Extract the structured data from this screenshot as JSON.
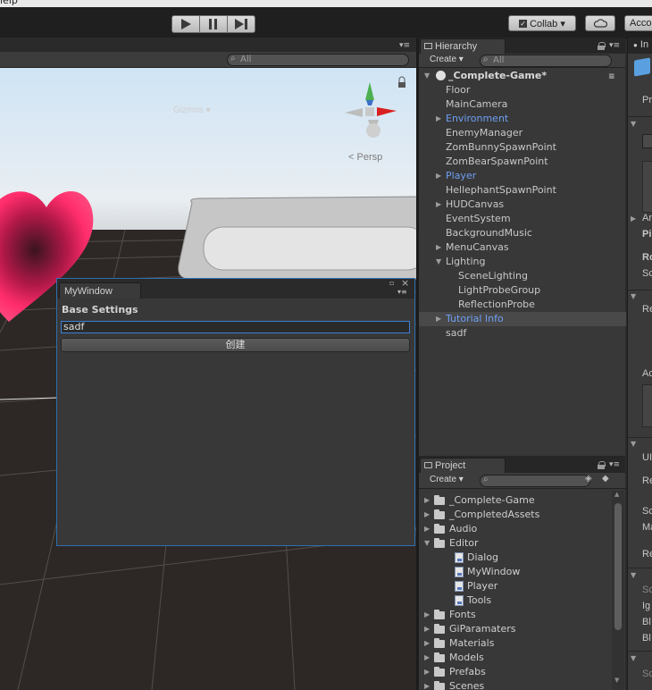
{
  "menubar": {
    "partial_label": "lelp"
  },
  "toolbar": {
    "collab_label": "Collab ▾",
    "account_label": "Acco"
  },
  "scene": {
    "gizmos_label": "Gizmos ▾",
    "search_placeholder": "All",
    "persp_label": "Persp"
  },
  "hierarchy": {
    "tab_label": "Hierarchy",
    "create_label": "Create ▾",
    "search_placeholder": "All",
    "root_label": "_Complete-Game*",
    "items": [
      {
        "label": "Floor",
        "indent": 0,
        "foldout": false,
        "color": "normal"
      },
      {
        "label": "MainCamera",
        "indent": 0,
        "foldout": false,
        "color": "normal"
      },
      {
        "label": "Environment",
        "indent": 0,
        "foldout": "collapsed",
        "color": "blue"
      },
      {
        "label": "EnemyManager",
        "indent": 0,
        "foldout": false,
        "color": "normal"
      },
      {
        "label": "ZomBunnySpawnPoint",
        "indent": 0,
        "foldout": false,
        "color": "normal"
      },
      {
        "label": "ZomBearSpawnPoint",
        "indent": 0,
        "foldout": false,
        "color": "normal"
      },
      {
        "label": "Player",
        "indent": 0,
        "foldout": "collapsed",
        "color": "blue"
      },
      {
        "label": "HellephantSpawnPoint",
        "indent": 0,
        "foldout": false,
        "color": "normal"
      },
      {
        "label": "HUDCanvas",
        "indent": 0,
        "foldout": "collapsed",
        "color": "normal"
      },
      {
        "label": "EventSystem",
        "indent": 0,
        "foldout": false,
        "color": "normal"
      },
      {
        "label": "BackgroundMusic",
        "indent": 0,
        "foldout": false,
        "color": "normal"
      },
      {
        "label": "MenuCanvas",
        "indent": 0,
        "foldout": "collapsed",
        "color": "normal"
      },
      {
        "label": "Lighting",
        "indent": 0,
        "foldout": "expanded",
        "color": "normal"
      },
      {
        "label": "SceneLighting",
        "indent": 1,
        "foldout": false,
        "color": "normal"
      },
      {
        "label": "LightProbeGroup",
        "indent": 1,
        "foldout": false,
        "color": "normal"
      },
      {
        "label": "ReflectionProbe",
        "indent": 1,
        "foldout": false,
        "color": "normal"
      },
      {
        "label": "Tutorial Info",
        "indent": 0,
        "foldout": "collapsed",
        "color": "blue",
        "selected": true
      },
      {
        "label": "sadf",
        "indent": 0,
        "foldout": false,
        "color": "normal"
      }
    ]
  },
  "project": {
    "tab_label": "Project",
    "create_label": "Create ▾",
    "items": [
      {
        "label": "_Complete-Game",
        "type": "folder",
        "indent": 0,
        "foldout": "collapsed"
      },
      {
        "label": "_CompletedAssets",
        "type": "folder",
        "indent": 0,
        "foldout": "collapsed"
      },
      {
        "label": "Audio",
        "type": "folder",
        "indent": 0,
        "foldout": "collapsed"
      },
      {
        "label": "Editor",
        "type": "folder",
        "indent": 0,
        "foldout": "expanded"
      },
      {
        "label": "Dialog",
        "type": "script",
        "indent": 1,
        "foldout": false
      },
      {
        "label": "MyWindow",
        "type": "script",
        "indent": 1,
        "foldout": false
      },
      {
        "label": "Player",
        "type": "script",
        "indent": 1,
        "foldout": false
      },
      {
        "label": "Tools",
        "type": "script",
        "indent": 1,
        "foldout": false
      },
      {
        "label": "Fonts",
        "type": "folder",
        "indent": 0,
        "foldout": "collapsed"
      },
      {
        "label": "GiParamaters",
        "type": "folder",
        "indent": 0,
        "foldout": "collapsed"
      },
      {
        "label": "Materials",
        "type": "folder",
        "indent": 0,
        "foldout": "collapsed"
      },
      {
        "label": "Models",
        "type": "folder",
        "indent": 0,
        "foldout": "collapsed"
      },
      {
        "label": "Prefabs",
        "type": "folder",
        "indent": 0,
        "foldout": "collapsed"
      },
      {
        "label": "Scenes",
        "type": "folder",
        "indent": 0,
        "foldout": "collapsed"
      }
    ]
  },
  "mywindow": {
    "tab_label": "MyWindow",
    "heading": "Base Settings",
    "input_value": "sadf",
    "create_button_label": "创建"
  },
  "inspector": {
    "tab_label": "In",
    "labels": [
      {
        "text": "Pr",
        "style": "normal"
      },
      {
        "text": "Sc",
        "style": "normal"
      },
      {
        "text": "Ar",
        "style": "normal"
      },
      {
        "text": "Pi",
        "style": "bold"
      },
      {
        "text": "Ro",
        "style": "bold"
      },
      {
        "text": "Sc",
        "style": "normal"
      },
      {
        "text": "Re",
        "style": "normal"
      },
      {
        "text": "Ac",
        "style": "normal"
      },
      {
        "text": "UI",
        "style": "normal"
      },
      {
        "text": "Re",
        "style": "normal"
      },
      {
        "text": "Sc",
        "style": "normal"
      },
      {
        "text": "Ma",
        "style": "normal"
      },
      {
        "text": "Re",
        "style": "normal"
      },
      {
        "text": "Sc",
        "style": "dim"
      },
      {
        "text": "Ig",
        "style": "normal"
      },
      {
        "text": "Bl",
        "style": "normal"
      },
      {
        "text": "Bl",
        "style": "normal"
      },
      {
        "text": "Sc",
        "style": "dim"
      }
    ]
  },
  "colors": {
    "selection_blue": "#2f6fb0",
    "prefab_blue": "#6f9ff5",
    "heart_pink": "#ff2d6b",
    "panel_bg": "#383838"
  },
  "icons": [
    "play-icon",
    "pause-icon",
    "step-icon",
    "cloud-icon",
    "lock-icon",
    "menu-icon",
    "folder-icon",
    "script-icon",
    "unity-scene-icon"
  ]
}
